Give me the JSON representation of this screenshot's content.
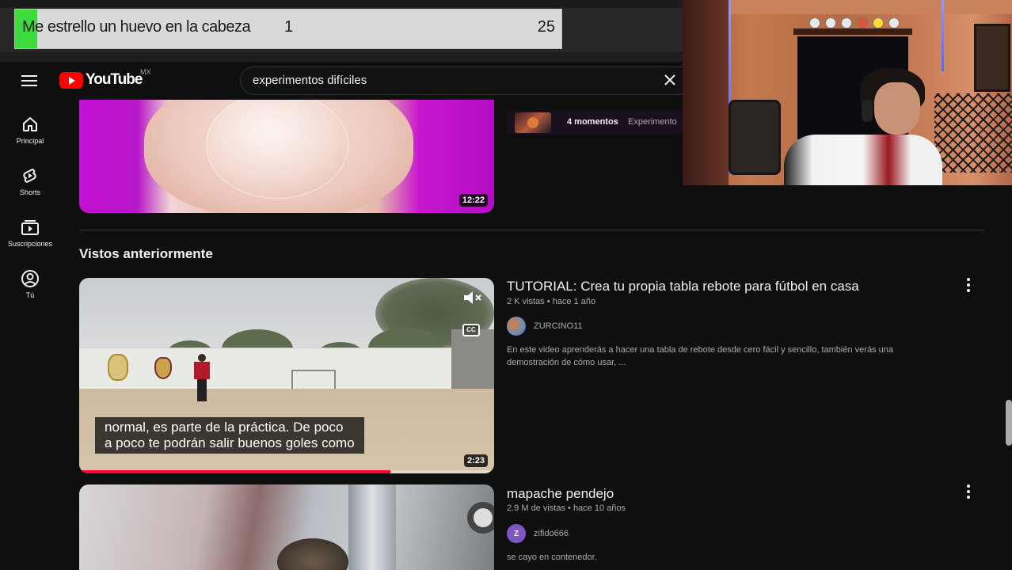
{
  "stream_goal": {
    "title": "Me estrello un huevo en la cabeza",
    "current": "1",
    "target": "25",
    "progress": 0.04,
    "fill_color": "#3ddc3d"
  },
  "header": {
    "logo_text": "YouTube",
    "region": "MX",
    "search_value": "experimentos difíciles",
    "menu_icon": "hamburger-menu-icon",
    "clear_icon": "close-icon"
  },
  "sidebar": {
    "items": [
      {
        "label": "Principal",
        "icon": "home-icon"
      },
      {
        "label": "Shorts",
        "icon": "shorts-icon"
      },
      {
        "label": "Suscripciones",
        "icon": "subscriptions-icon"
      },
      {
        "label": "Tú",
        "icon": "account-icon"
      }
    ]
  },
  "top_video": {
    "duration": "12:22",
    "moments_count": "4 momentos",
    "moments_tag": "Experimento"
  },
  "section": {
    "title": "Vistos anteriormente"
  },
  "videos": [
    {
      "title": "TUTORIAL: Crea tu propia tabla rebote para fútbol en casa",
      "meta": "2 K vistas • hace 1 año",
      "channel": "ZURCINO11",
      "description_line1": "En este video aprenderás a hacer una tabla de rebote desde cero fácil y sencillo, también verás una",
      "description_line2": "demostración de cómo usar, ...",
      "duration": "2:23",
      "caption_line1": "normal, es parte de la práctica. De poco",
      "caption_line2": "a poco te podrán salir buenos goles como",
      "cc_label": "CC",
      "watch_progress": 0.75,
      "avatar_color": "#6f8fb3"
    },
    {
      "title": "mapache pendejo",
      "meta": "2.9 M de vistas • hace 10 años",
      "channel": "zifido666",
      "avatar_letter": "Z",
      "description_line1": "se cayo en contenedor.",
      "avatar_color": "#7e57c2"
    }
  ],
  "colors": {
    "background": "#0f0f0f",
    "accent_red": "#ff0000",
    "progress_red": "#ff0033",
    "muted_text": "#aaaaaa"
  }
}
